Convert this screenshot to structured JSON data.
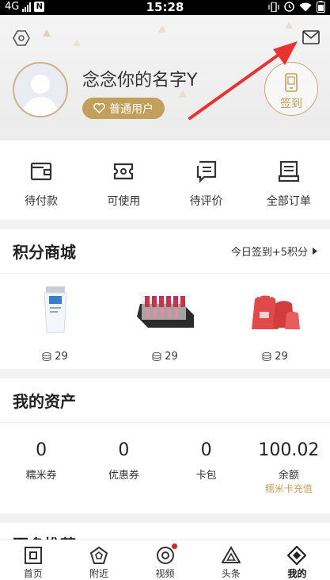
{
  "status_bar": {
    "network": "4G",
    "time": "15:28",
    "notification_badge": "N"
  },
  "header": {
    "username": "念念你的名字Y",
    "member_level": "普通用户",
    "signin_label": "签到"
  },
  "orders": [
    {
      "label": "待付款",
      "icon": "wallet-icon"
    },
    {
      "label": "可使用",
      "icon": "ticket-icon"
    },
    {
      "label": "待评价",
      "icon": "comment-icon"
    },
    {
      "label": "全部订单",
      "icon": "order-list-icon"
    }
  ],
  "points_mall": {
    "title": "积分商城",
    "signin_hint": "今日签到+5积分",
    "products": [
      {
        "points": "29",
        "image": "cleanser-tube"
      },
      {
        "points": "29",
        "image": "lipstick-set"
      },
      {
        "points": "29",
        "image": "red-drawstring-bags"
      }
    ]
  },
  "assets": {
    "title": "我的资产",
    "items": [
      {
        "value": "0",
        "label": "糯米券",
        "sub": ""
      },
      {
        "value": "0",
        "label": "优惠券",
        "sub": ""
      },
      {
        "value": "0",
        "label": "卡包",
        "sub": ""
      },
      {
        "value": "100.02",
        "label": "余额",
        "sub": "糯米卡充值"
      }
    ]
  },
  "more": {
    "title": "更多推荐"
  },
  "tabbar": [
    {
      "label": "首页",
      "icon": "home-icon",
      "active": false
    },
    {
      "label": "附近",
      "icon": "nearby-icon",
      "active": false
    },
    {
      "label": "视频",
      "icon": "video-icon",
      "active": false,
      "dot": true
    },
    {
      "label": "头条",
      "icon": "headline-icon",
      "active": false
    },
    {
      "label": "我的",
      "icon": "mine-icon",
      "active": true
    }
  ],
  "colors": {
    "accent_gold": "#c2a05c",
    "arrow_red": "#e8332f",
    "badge_red": "#e02020"
  }
}
